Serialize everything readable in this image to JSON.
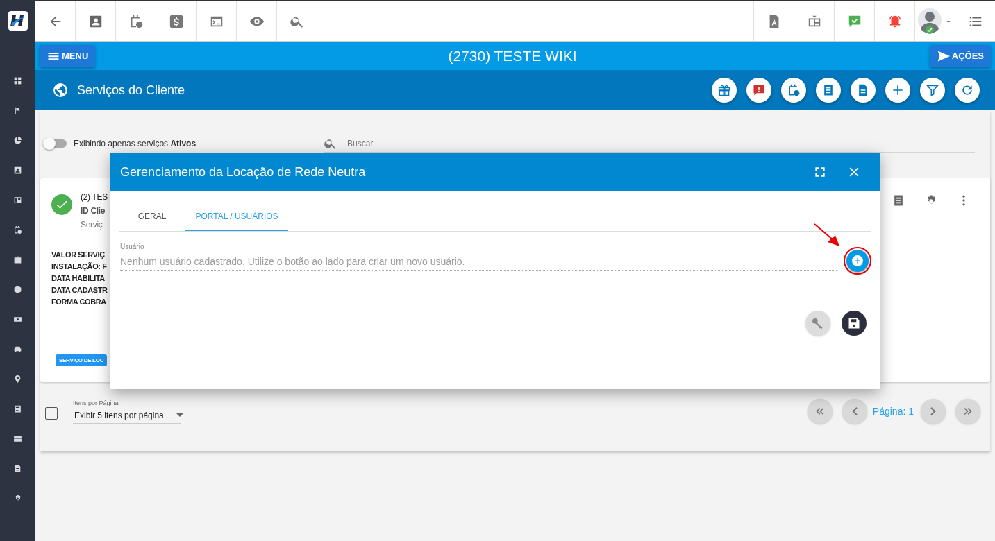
{
  "header": {
    "menu_button": "MENU",
    "title": "(2730) TESTE WIKI",
    "actions_button": "AÇÕES"
  },
  "section": {
    "title": "Serviços do Cliente"
  },
  "filter": {
    "toggle_label": "Exibindo apenas serviços **Ativos**",
    "on": false,
    "search_placeholder": "Buscar"
  },
  "service_card": {
    "title": "(2) TES",
    "client_id": "ID Clie",
    "service": "Serviç",
    "details": [
      "VALOR SERVIÇ",
      "INSTALAÇÃO: F",
      "DATA HABILITA",
      "DATA CADASTR",
      "FORMA COBRA"
    ],
    "tag": "SERVIÇO DE LOC"
  },
  "pagination": {
    "select_all_checked": false,
    "per_page_label": "Itens por Página",
    "per_page_value": "Exibir 5 itens por página",
    "page": "Página: 1"
  },
  "modal": {
    "title": "Gerenciamento da Locação de Rede Neutra",
    "tabs": [
      {
        "label": "GERAL",
        "selected": false
      },
      {
        "label": "PORTAL / USUÁRIOS",
        "selected": true
      }
    ],
    "field_label": "Usuário",
    "empty_message": "Nenhum usuário cadastrado. Utilize o botão ao lado para criar um novo usuário."
  }
}
